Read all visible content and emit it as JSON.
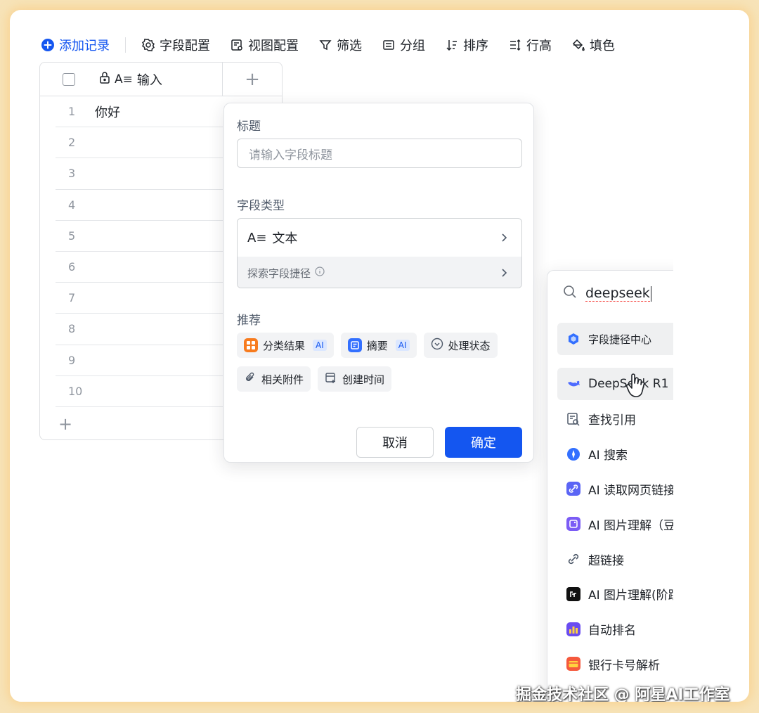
{
  "toolbar": {
    "add_record": "添加记录",
    "field_config": "字段配置",
    "view_config": "视图配置",
    "filter": "筛选",
    "group": "分组",
    "sort": "排序",
    "row_height": "行高",
    "fill_color": "填色"
  },
  "table": {
    "column_header": "输入",
    "add_column": "+",
    "add_row": "+",
    "rows": [
      {
        "num": "1",
        "value": "你好"
      },
      {
        "num": "2",
        "value": ""
      },
      {
        "num": "3",
        "value": ""
      },
      {
        "num": "4",
        "value": ""
      },
      {
        "num": "5",
        "value": ""
      },
      {
        "num": "6",
        "value": ""
      },
      {
        "num": "7",
        "value": ""
      },
      {
        "num": "8",
        "value": ""
      },
      {
        "num": "9",
        "value": ""
      },
      {
        "num": "10",
        "value": ""
      }
    ]
  },
  "field_panel": {
    "title_label": "标题",
    "title_placeholder": "请输入字段标题",
    "type_label": "字段类型",
    "type_value": "文本",
    "shortcut_explore": "探索字段捷径",
    "recommend_label": "推荐",
    "recommend": [
      {
        "label": "分类结果",
        "badge": "AI",
        "color": "#f77b1e"
      },
      {
        "label": "摘要",
        "badge": "AI",
        "color": "#3370ff"
      },
      {
        "label": "处理状态",
        "badge": "",
        "color": ""
      },
      {
        "label": "相关附件",
        "badge": "",
        "color": ""
      },
      {
        "label": "创建时间",
        "badge": "",
        "color": ""
      }
    ],
    "cancel": "取消",
    "confirm": "确定"
  },
  "shortcut_panel": {
    "search_value": "deepseek",
    "center_label": "字段捷径中心",
    "items": [
      {
        "label": "DeepSeek R1",
        "icon": "deepseek-whale-icon",
        "color": "#4d6bfe"
      },
      {
        "label": "查找引用",
        "icon": "lookup-icon",
        "color": "#646a73"
      },
      {
        "label": "AI 搜索",
        "icon": "ai-search-icon",
        "color": "#3370ff"
      },
      {
        "label": "AI 读取网页链接",
        "icon": "link-reader-icon",
        "color": "#5b65f5"
      },
      {
        "label": "AI 图片理解（豆包）",
        "icon": "image-understand-icon",
        "color": "#7b5cf5"
      },
      {
        "label": "超链接",
        "icon": "hyperlink-icon",
        "color": "#646a73"
      },
      {
        "label": "AI 图片理解(阶跃星辰)",
        "icon": "stepfun-icon",
        "color": "#111111"
      },
      {
        "label": "自动排名",
        "icon": "auto-rank-icon",
        "color": "#6a4cf0"
      },
      {
        "label": "银行卡号解析",
        "icon": "bank-card-icon",
        "color": "#f5593d"
      }
    ]
  },
  "watermark": "掘金技术社区 @ 阿星AI工作室"
}
